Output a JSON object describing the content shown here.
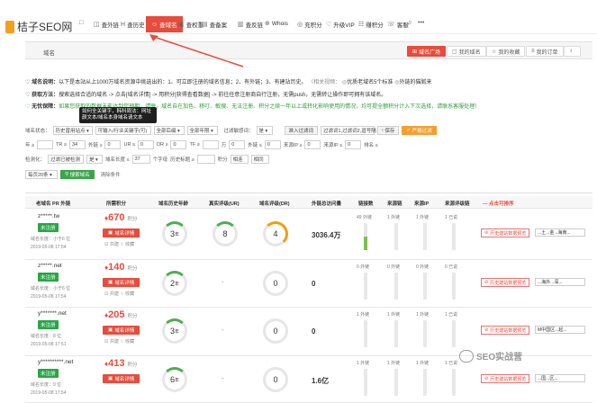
{
  "nav": {
    "logo": "桔子SEO网",
    "items": [
      {
        "icon": "□",
        "label": ""
      },
      {
        "icon": "◫",
        "label": "查外链"
      },
      {
        "icon": "H",
        "label": "查历史"
      },
      {
        "icon": "☺",
        "label": "查域名"
      },
      {
        "icon": "▣",
        "label": "查权重"
      },
      {
        "icon": "▤",
        "label": "查备案"
      },
      {
        "icon": "▥",
        "label": "查反链"
      },
      {
        "icon": "⊕",
        "label": "Whois"
      },
      {
        "icon": "◎",
        "label": "充积分"
      },
      {
        "icon": "♡",
        "label": "升级VIP"
      },
      {
        "icon": "☷",
        "label": "赚积分"
      },
      {
        "icon": "☏",
        "label": "客服"
      },
      {
        "icon": "♫",
        "label": ""
      },
      {
        "icon": "•••",
        "label": ""
      }
    ]
  },
  "tabs": {
    "current": "域名",
    "buttons": [
      {
        "label": "域名广场",
        "icon": "⊞"
      },
      {
        "label": "我的域名",
        "icon": "▢"
      },
      {
        "label": "我的收藏",
        "icon": "☆"
      },
      {
        "label": "我的订单",
        "icon": "≡"
      },
      {
        "label": "",
        "icon": "♁"
      }
    ]
  },
  "info": {
    "line1_label": "域名说明：",
    "line1_text": "以下是本站从上1000万域名资源中挑选出的：1、可立即注册的域名信息；2、有外链；3、有建站历史。",
    "line1_grey": "（相关视频：",
    "line1_link1": "优质老域名5个标准",
    "line1_link2": "外链的猫腻来",
    "line2_label": "获取方法：",
    "line2_text": "搜索选择合适的域名 -> 点击[域名详情] -> 用积分[获得查看数据] -> 前往任意注册商自行注册，无需push，无需转让操作即可拥有该域名。",
    "line3_label": "无忧保障：",
    "line3_text": "如果您获取的数据未能达到您预期，请联，域名自在加色、移叮、敏搜、无法注册、积分之续一年以上或转化影响使用的情况，均可提全额积分",
    "line3_tail": "计入下次选择，请联系客服处理）"
  },
  "tooltip": "如何全关键字，韩科周法：网址颜文本/域名本身域名请文本",
  "filters": {
    "row1": {
      "label1": "域名状态：",
      "select1": "历史曾用站点 ▾",
      "input1_placeholder": "可输入/行业关键字(可)",
      "select2": "全部后缀 ▾",
      "select3": "全部年限 ▾",
      "label2": "过滤敏感词：",
      "select4": "是 ▾",
      "input2": "准入过滤词",
      "input3": "过滤词1,过滤词2,逗号隔",
      "btn1": "保存",
      "btn2": "严格过滤"
    },
    "row2": {
      "fields": [
        {
          "label": "TR ≥",
          "value": ""
        },
        {
          "label": "外链 ≥",
          "value": "34"
        },
        {
          "label": "UR ≤",
          "value": "0"
        },
        {
          "label": "DR ≥",
          "value": "0"
        },
        {
          "label": "TF ≥",
          "value": "0"
        },
        {
          "label": "万",
          "value": ""
        },
        {
          "label": "外链 ≤",
          "value": "0"
        },
        {
          "label": "来源IP ≥",
          "value": "0"
        },
        {
          "label": "来源IP ≤",
          "value": "0"
        },
        {
          "label": "排名 ≤",
          "value": "0"
        }
      ],
      "prefix": "年 ≥"
    },
    "row3": {
      "label1": "检测化：",
      "select1": "过滤已被检测",
      "select2": "是 ▾",
      "label2": "域名长度 ≤",
      "value2": "37",
      "label3": "个字母",
      "label4": "历史标题 ≥",
      "label5": "积分",
      "select3": "相连",
      "select4": "相同"
    },
    "row4": {
      "select1": "每页20条 ▾",
      "search_btn": "搜索域名",
      "reset": "清除条件"
    }
  },
  "table": {
    "headers": [
      "老域名 PR 外链",
      "所需积分",
      "域名历史年龄",
      "真实评级(UR)",
      "域名评级(DR)",
      "外链总访问量",
      "链接数",
      "来源链",
      "来源IP",
      "来源评级链",
      "— 点击可排序"
    ],
    "rows": [
      {
        "domain": "z*****.tw",
        "badge": "未注册",
        "meta1": "域名长度：小于6 位",
        "meta2": "2019-05-08 17:54",
        "points": "670",
        "points_unit": "积分",
        "detail": "域名详情",
        "actions": "☑ 共建  ☆ 收藏",
        "age": "3",
        "age_unit": "年",
        "ur": "8",
        "dr": "4",
        "traffic": "3036.4万",
        "c1": "49 外链",
        "c2": "1 外链",
        "c3": "1 外链",
        "c4": "1 已说",
        "bar_fill": 0.5,
        "history": "历史建站数据预览",
        "tags": "...土...金...海南..."
      },
      {
        "domain": "z*****.net",
        "badge": "未注册",
        "meta1": "域名长度：小于6 位",
        "meta2": "2019-05-08 17:54",
        "points": "140",
        "points_unit": "积分",
        "detail": "域名详情",
        "actions": "☑ 共建  ☆ 收藏",
        "age": "2",
        "age_unit": "年",
        "ur": "-",
        "dr": "0",
        "traffic": "0",
        "c1": "0 外链",
        "c2": "0 外链",
        "c3": "0 外链",
        "c4": "0 已说",
        "bar_fill": 0,
        "history": "历史建站数据预览",
        "tags": "...海外...深..."
      },
      {
        "domain": "y*******.net",
        "badge": "未注册",
        "meta1": "域名长度：8 位",
        "meta2": "2019-05-08 17:51",
        "points": "205",
        "points_unit": "积分",
        "detail": "域名详情",
        "actions": "☑ 共建  ☆ 收藏",
        "age": "3",
        "age_unit": "年",
        "ur": "-",
        "dr": "0",
        "traffic": "0",
        "c1": "1 外链",
        "c2": "1 外链",
        "c3": "1 外链",
        "c4": "1 已说",
        "bar_fill": 0,
        "history": "历史建站数据预览",
        "tags": "M中国区...起..."
      },
      {
        "domain": "y**********.net",
        "badge": "未注册",
        "meta1": "域名长度：9 位",
        "meta2": "2019-05-08 17:54",
        "points": "413",
        "points_unit": "积分",
        "detail": "域名详情",
        "actions": "",
        "age": "6",
        "age_unit": "年",
        "ur": "-",
        "dr": "0",
        "traffic": "1.6亿",
        "c1": "1 外链",
        "c2": "1 外链",
        "c3": "1 外链",
        "c4": "1 已说",
        "bar_fill": 0,
        "history": "历史建站数据预览",
        "tags": "...国...区..."
      }
    ]
  },
  "watermark": "SEO实战营",
  "colors": {
    "accent": "#e74c3c",
    "badge": "#27a745",
    "orange": "#f3a030"
  }
}
